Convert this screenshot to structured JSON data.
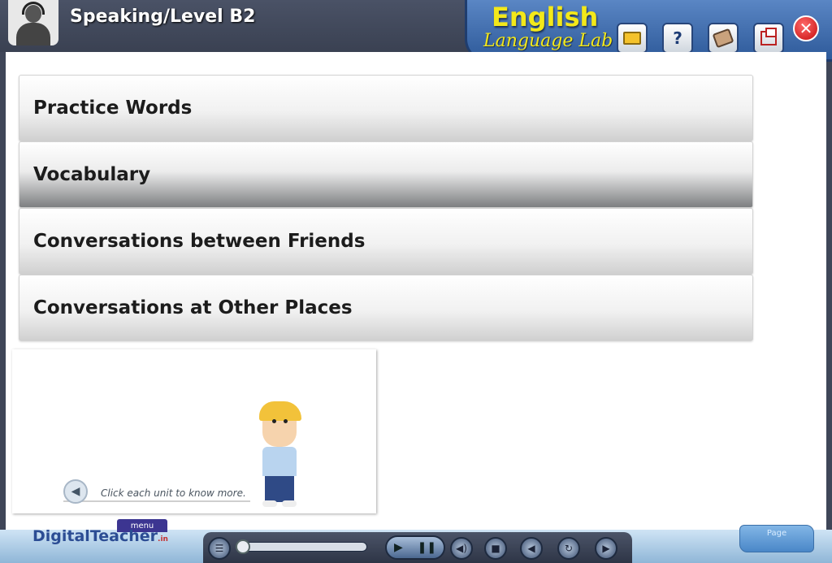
{
  "header": {
    "title": "Speaking/Level B2",
    "brand_line1": "English",
    "brand_line2": "Language Lab",
    "buttons": {
      "help_label": "?",
      "close_label": "✕"
    }
  },
  "menu": {
    "items": [
      {
        "label": "Practice Words"
      },
      {
        "label": "Vocabulary"
      },
      {
        "label": "Conversations between Friends"
      },
      {
        "label": "Conversations at Other Places"
      }
    ]
  },
  "hint": {
    "text": "Click each unit to know more."
  },
  "footer": {
    "logo_text1": "Digital",
    "logo_text2": "Teacher",
    "logo_suffix": ".in",
    "menu_tab": "menu",
    "page_label": "Page"
  },
  "colors": {
    "brand_yellow": "#f3e81a",
    "header_bg": "#3f4658",
    "close_red": "#c50d0d"
  },
  "icons": [
    "folder-icon",
    "help-icon",
    "book-icon",
    "window-icon",
    "close-icon",
    "tree-icon",
    "play-icon",
    "pause-icon",
    "volume-icon",
    "stop-icon",
    "back-icon",
    "refresh-icon",
    "next-icon"
  ]
}
